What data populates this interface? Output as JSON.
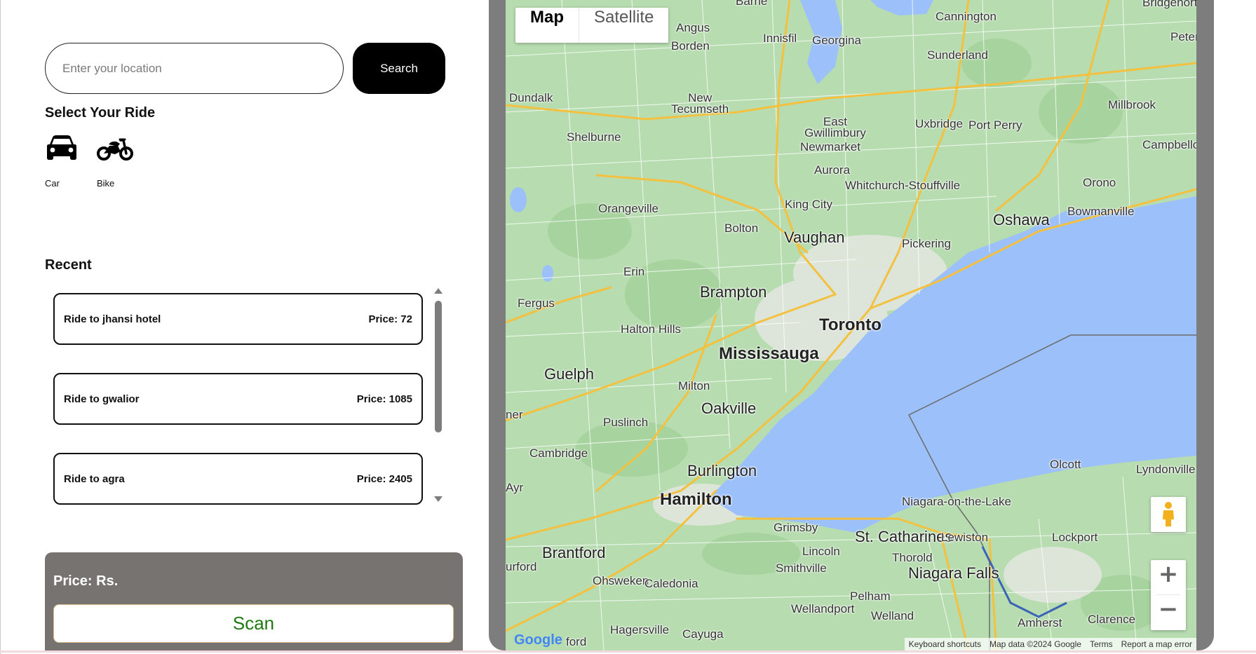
{
  "search": {
    "placeholder": "Enter your location",
    "button_label": "Search"
  },
  "ride_select": {
    "title": "Select Your Ride",
    "options": [
      {
        "label": "Car",
        "icon": "car-icon"
      },
      {
        "label": "Bike",
        "icon": "motorcycle-icon"
      }
    ]
  },
  "recent": {
    "title": "Recent",
    "items": [
      {
        "destination": "Ride to jhansi hotel",
        "price": "Price: 72"
      },
      {
        "destination": "Ride to gwalior",
        "price": "Price: 1085"
      },
      {
        "destination": "Ride to agra",
        "price": "Price: 2405"
      }
    ]
  },
  "price_panel": {
    "price_text": "Price: Rs.",
    "scan_label": "Scan"
  },
  "map": {
    "type_active": "Map",
    "type_inactive": "Satellite",
    "zoom_in": "+",
    "zoom_out": "−",
    "logo": "Google",
    "attribution": [
      "Keyboard shortcuts",
      "Map data ©2024 Google",
      "Terms",
      "Report a map error"
    ],
    "colors": {
      "land": "#b7dcb0",
      "water": "#9cc0f9",
      "roads": "#f3c13f",
      "panel": "#767371"
    },
    "cities": {
      "toronto": "Toronto",
      "mississauga": "Mississauga",
      "hamilton": "Hamilton",
      "brampton": "Brampton",
      "vaughan": "Vaughan",
      "oakville": "Oakville",
      "burlington": "Burlington",
      "guelph": "Guelph",
      "oshawa": "Oshawa",
      "niagara_falls": "Niagara Falls",
      "st_catharines": "St. Catharines",
      "brantford": "Brantford",
      "cambridge": "Cambridge",
      "milton": "Milton",
      "halton_hills": "Halton Hills",
      "erin": "Erin",
      "orangeville": "Orangeville",
      "bolton": "Bolton",
      "king_city": "King City",
      "aurora": "Aurora",
      "newmarket": "Newmarket",
      "east_gwillimbury": "East\nGwillimbury",
      "georgina": "Georgina",
      "innisfil": "Innisfil",
      "angus": "Angus",
      "borden": "Borden",
      "new_tecumseth": "New\nTecumseth",
      "dundalk": "Dundalk",
      "shelburne": "Shelburne",
      "sunderland": "Sunderland",
      "uxbridge": "Uxbridge",
      "port_perry": "Port Perry",
      "cannington": "Cannington",
      "millbrook": "Millbrook",
      "campbellcroft": "Campbellcro",
      "orono": "Orono",
      "bowmanville": "Bowmanville",
      "pickering": "Pickering",
      "whitchurch": "Whitchurch-Stouffville",
      "fergus": "Fergus",
      "puslinch": "Puslinch",
      "grimsby": "Grimsby",
      "lincoln": "Lincoln",
      "smithville": "Smithville",
      "pelham": "Pelham",
      "wellandport": "Wellandport",
      "welland": "Welland",
      "thorold": "Thorold",
      "lewiston": "Lewiston",
      "lockport": "Lockport",
      "niagara_on_the_lake": "Niagara-on-the-Lake",
      "olcott": "Olcott",
      "lyndonville": "Lyndonville",
      "amherst": "Amherst",
      "clarence": "Clarence",
      "ohsweken": "Ohsweken",
      "caledonia": "Caledonia",
      "hagersville": "Hagersville",
      "cayuga": "Cayuga",
      "waterford": "urford",
      "ayr": "Ayr",
      "kitchener": "ner",
      "barrie": "Barrie",
      "peterborough": "Peterbo",
      "bridgenorth": "Bridgenorth",
      "ford": "ford"
    }
  }
}
